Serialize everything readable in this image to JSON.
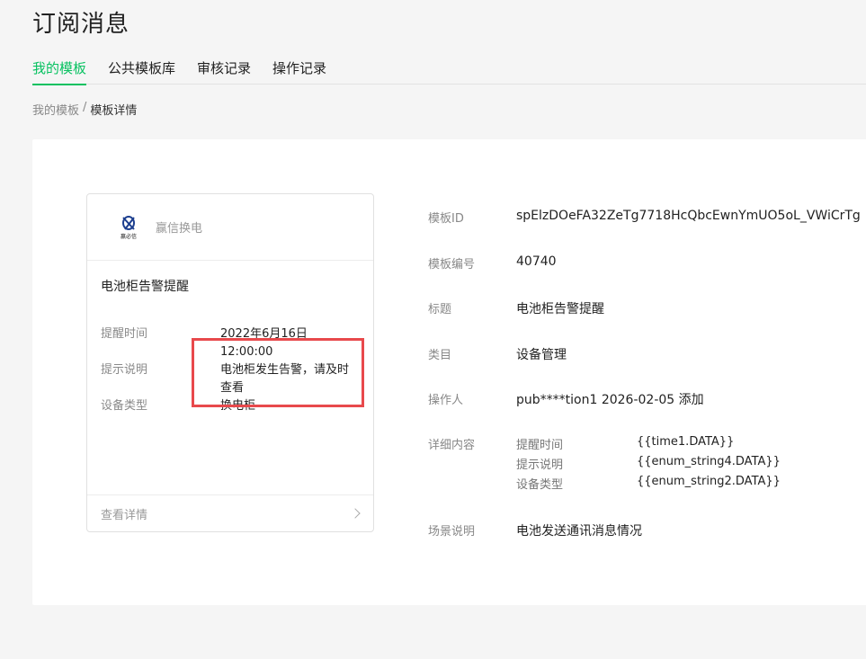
{
  "header": {
    "title": "订阅消息"
  },
  "tabs": [
    {
      "label": "我的模板",
      "active": true
    },
    {
      "label": "公共模板库",
      "active": false
    },
    {
      "label": "审核记录",
      "active": false
    },
    {
      "label": "操作记录",
      "active": false
    }
  ],
  "breadcrumb": {
    "parent": "我的模板",
    "separator": "/",
    "current": "模板详情"
  },
  "preview": {
    "account_name": "赢信换电",
    "logo_caption": "赢必信",
    "message_title": "电池柜告警提醒",
    "fields": [
      {
        "key": "提醒时间",
        "value": "2022年6月16日 12:00:00"
      },
      {
        "key": "提示说明",
        "value": "电池柜发生告警，请及时查看"
      },
      {
        "key": "设备类型",
        "value": "换电柜"
      }
    ],
    "footer_label": "查看详情",
    "highlight_color": "#e8494c"
  },
  "details": {
    "template_id_label": "模板ID",
    "template_id": "spElzDOeFA32ZeTg7718HcQbcEwnYmUO5oL_VWiCrTg",
    "template_no_label": "模板编号",
    "template_no": "40740",
    "title_label": "标题",
    "title": "电池柜告警提醒",
    "category_label": "类目",
    "category": "设备管理",
    "operator_label": "操作人",
    "operator": "pub****tion1 2026-02-05 添加",
    "content_label": "详细内容",
    "content": [
      {
        "key": "提醒时间",
        "value": "{{time1.DATA}}"
      },
      {
        "key": "提示说明",
        "value": "{{enum_string4.DATA}}"
      },
      {
        "key": "设备类型",
        "value": "{{enum_string2.DATA}}"
      }
    ],
    "scene_label": "场景说明",
    "scene": "电池发送通讯消息情况"
  },
  "colors": {
    "accent": "#07c160"
  }
}
